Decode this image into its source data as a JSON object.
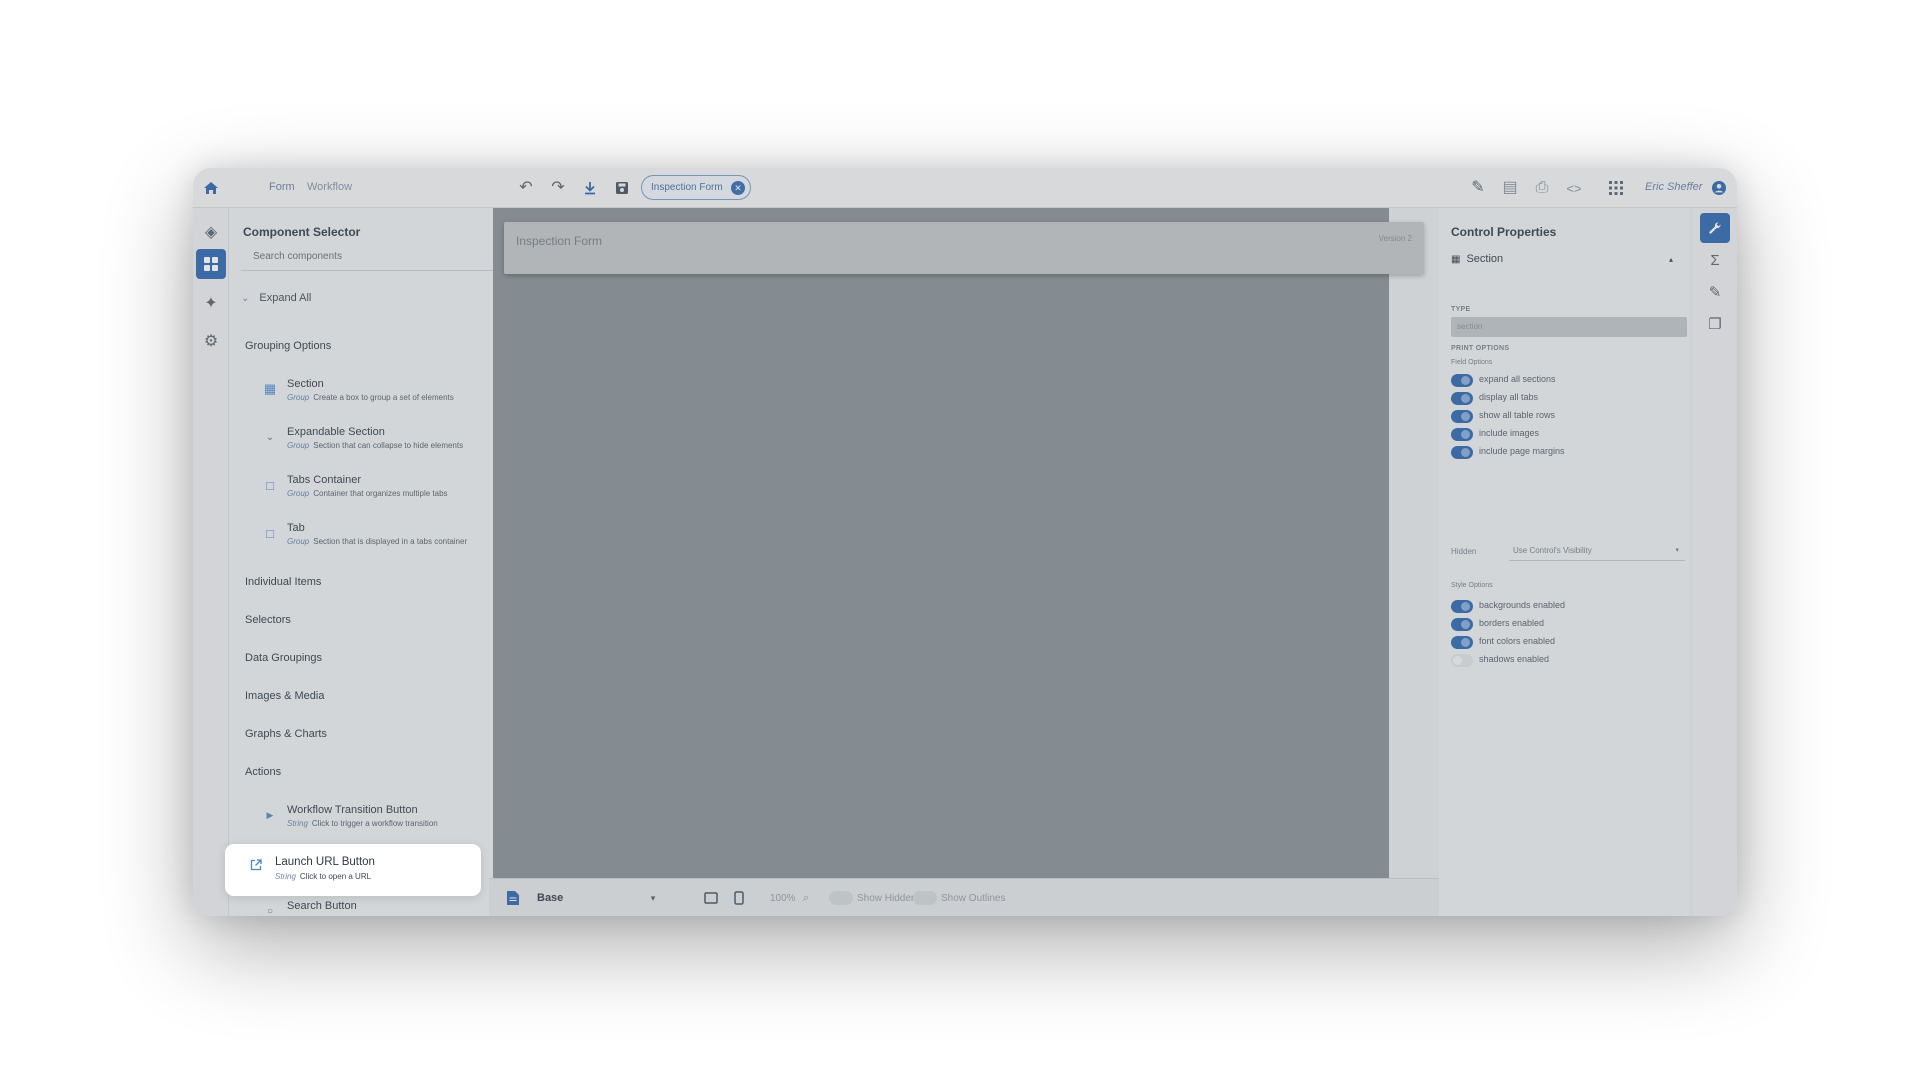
{
  "topbar": {
    "tabs": [
      "Form",
      "Workflow"
    ],
    "form_chip": "Inspection Form",
    "user": "Eric Sheffer"
  },
  "component_selector": {
    "title": "Component Selector",
    "search_placeholder": "Search components",
    "expand_all": "Expand All",
    "categories": [
      {
        "label": "Grouping Options",
        "expanded": true
      },
      {
        "label": "Individual Items",
        "expanded": false
      },
      {
        "label": "Selectors",
        "expanded": false
      },
      {
        "label": "Data Groupings",
        "expanded": false
      },
      {
        "label": "Images & Media",
        "expanded": false
      },
      {
        "label": "Graphs & Charts",
        "expanded": false
      },
      {
        "label": "Actions",
        "expanded": true
      }
    ],
    "grouping_items": [
      {
        "name": "Section",
        "type": "Group",
        "desc": "Create a box to group a set of elements"
      },
      {
        "name": "Expandable Section",
        "type": "Group",
        "desc": "Section that can collapse to hide elements"
      },
      {
        "name": "Tabs Container",
        "type": "Group",
        "desc": "Container that organizes multiple tabs"
      },
      {
        "name": "Tab",
        "type": "Group",
        "desc": "Section that is displayed in a tabs container"
      }
    ],
    "action_items": [
      {
        "name": "Workflow Transition Button",
        "type": "String",
        "desc": "Click to trigger a workflow transition"
      },
      {
        "name": "Launch URL Button",
        "type": "String",
        "desc": "Click to open a URL"
      },
      {
        "name": "Search Button",
        "type": "",
        "desc": ""
      }
    ]
  },
  "canvas": {
    "form_title": "Inspection Form",
    "version": "Version 2"
  },
  "bottombar": {
    "layout": "Base",
    "zoom": "100%",
    "show_hidden": "Show Hidden",
    "show_outlines": "Show Outlines"
  },
  "control_properties": {
    "title": "Control Properties",
    "section_label": "Section",
    "type_label": "TYPE",
    "type_value": "section",
    "print_options_label": "PRINT OPTIONS",
    "field_options_label": "Field Options",
    "field_toggles": [
      {
        "label": "expand all sections",
        "on": true
      },
      {
        "label": "display all tabs",
        "on": true
      },
      {
        "label": "show all table rows",
        "on": true
      },
      {
        "label": "include images",
        "on": true
      },
      {
        "label": "include page margins",
        "on": true
      }
    ],
    "hidden_label": "Hidden",
    "hidden_value": "Use Control's Visibility",
    "style_options_label": "Style Options",
    "style_toggles": [
      {
        "label": "backgrounds enabled",
        "on": true
      },
      {
        "label": "borders enabled",
        "on": true
      },
      {
        "label": "font colors enabled",
        "on": true
      },
      {
        "label": "shadows enabled",
        "on": false
      }
    ]
  },
  "colors": {
    "accent": "#3a6fb3",
    "canvas": "#8f979d"
  }
}
